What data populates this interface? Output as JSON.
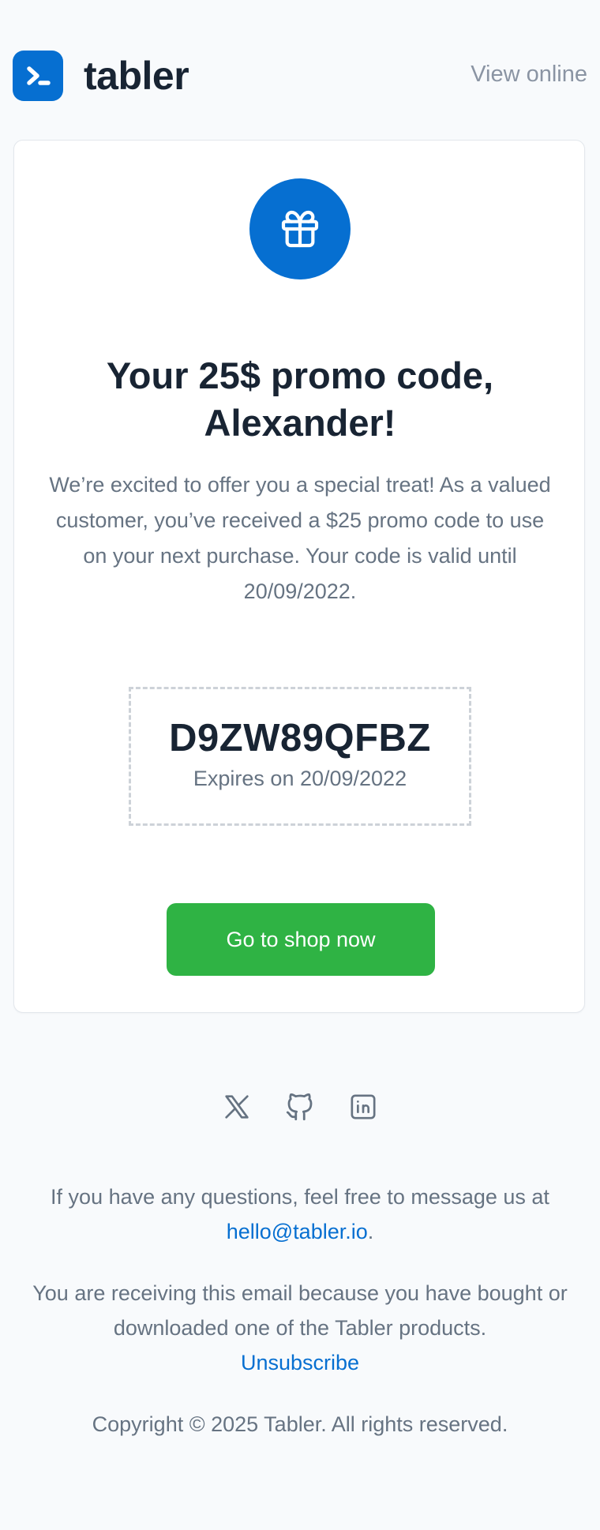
{
  "header": {
    "brand": "tabler",
    "view_online": "View online"
  },
  "card": {
    "icon": "gift-icon",
    "title": "Your 25$ promo code, Alexander!",
    "message": "We’re excited to offer you a special treat! As a valued customer, you’ve received a $25 promo code to use on your next purchase. Your code is valid until 20/09/2022.",
    "coupon": {
      "code": "D9ZW89QFBZ",
      "expiry": "Expires on 20/09/2022"
    },
    "cta_label": "Go to shop now"
  },
  "socials": [
    {
      "icon": "x-twitter-icon"
    },
    {
      "icon": "github-icon"
    },
    {
      "icon": "linkedin-icon"
    }
  ],
  "footer": {
    "questions_text": "If you have any questions, feel free to message us at",
    "email": "hello@tabler.io",
    "period": ".",
    "receiving_text": "You are receiving this email because you have bought or downloaded one of the Tabler products.",
    "unsubscribe": "Unsubscribe",
    "copyright": "Copyright © 2025 Tabler. All rights reserved."
  },
  "colors": {
    "primary": "#066fd1",
    "success": "#2fb344",
    "background": "#f8fafc",
    "text": "#182433",
    "muted": "#667382"
  }
}
